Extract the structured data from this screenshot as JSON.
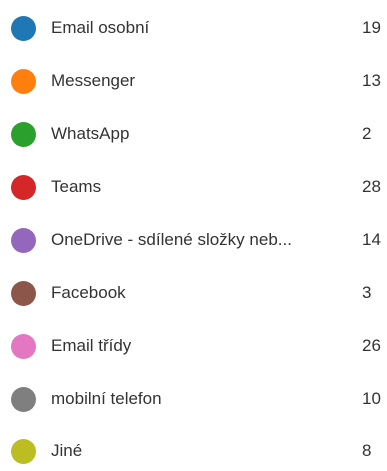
{
  "legend": {
    "items": [
      {
        "label": "Email osobní",
        "count": "19",
        "color": "#1f77b4"
      },
      {
        "label": "Messenger",
        "count": "13",
        "color": "#ff7f0e"
      },
      {
        "label": "WhatsApp",
        "count": "2",
        "color": "#2ca02c"
      },
      {
        "label": "Teams",
        "count": "28",
        "color": "#d62728"
      },
      {
        "label": "OneDrive - sdílené složky neb...",
        "count": "14",
        "color": "#9467bd"
      },
      {
        "label": "Facebook",
        "count": "3",
        "color": "#8c564b"
      },
      {
        "label": "Email třídy",
        "count": "26",
        "color": "#e377c2"
      },
      {
        "label": "mobilní telefon",
        "count": "10",
        "color": "#7f7f7f"
      },
      {
        "label": "Jiné",
        "count": "8",
        "color": "#bcbd22"
      }
    ]
  }
}
